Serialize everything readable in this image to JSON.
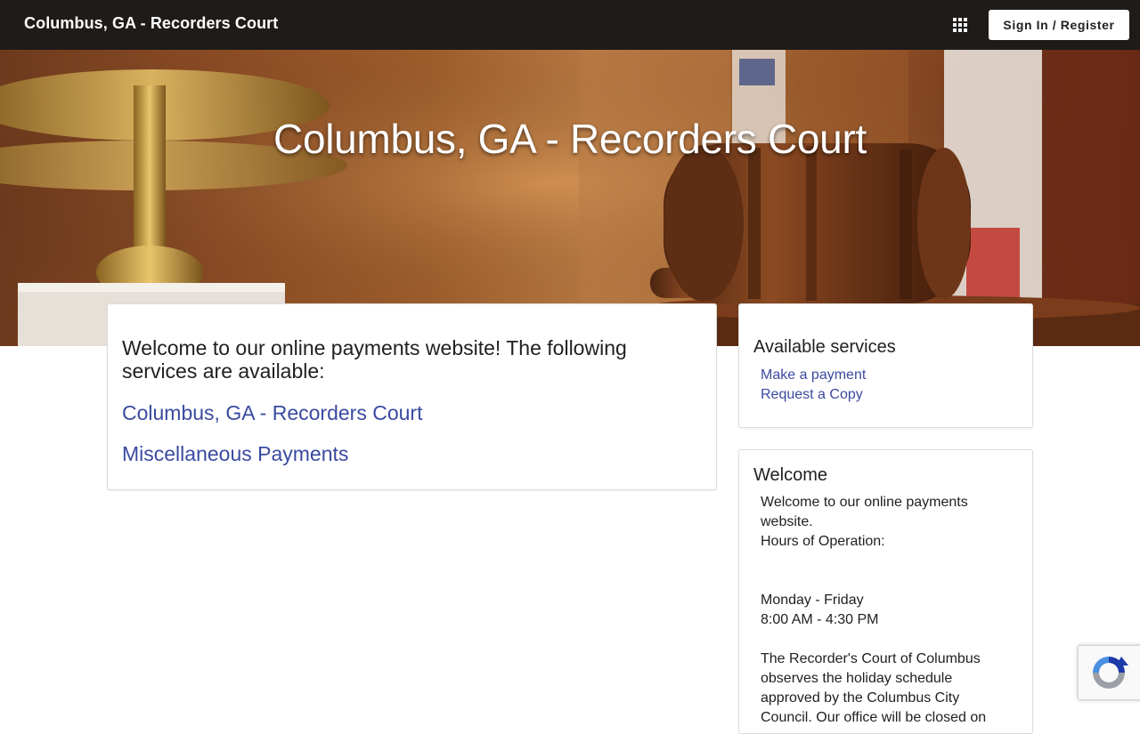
{
  "header": {
    "brand": "Columbus, GA - Recorders Court",
    "apps_icon": "grid-icon",
    "signin_label": "Sign In / Register"
  },
  "hero": {
    "title": "Columbus, GA - Recorders Court"
  },
  "main": {
    "heading": "Welcome to our online payments website! The following services are available:",
    "links": [
      "Columbus, GA - Recorders Court",
      "Miscellaneous Payments"
    ]
  },
  "services": {
    "title": "Available services",
    "links": [
      "Make a payment",
      "Request a Copy"
    ]
  },
  "welcome": {
    "title": "Welcome",
    "body": "Welcome to our online payments website.\nHours of Operation:\n\n\nMonday - Friday\n8:00 AM - 4:30 PM\n\nThe Recorder's Court of Columbus observes the holiday schedule approved by the Columbus City Council. Our office will be closed on"
  },
  "recaptcha": {
    "icon": "recaptcha-icon"
  },
  "colors": {
    "topbar": "#1f1b19",
    "link": "#3a4a9f"
  }
}
